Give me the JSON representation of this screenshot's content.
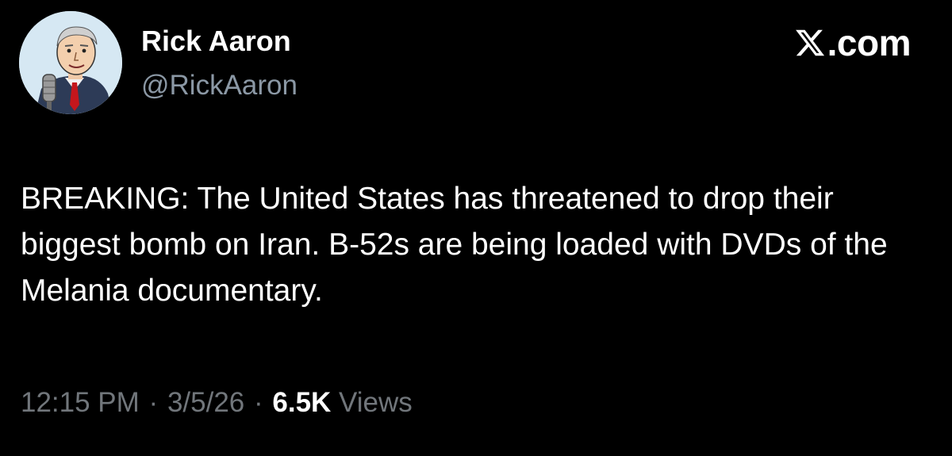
{
  "author": {
    "display_name": "Rick Aaron",
    "handle": "@RickAaron",
    "avatar_icon": "caricature-avatar-icon"
  },
  "source": {
    "logo_icon": "x-logo-icon",
    "label": ".com"
  },
  "tweet": {
    "text": "BREAKING: The United States has threatened to drop their biggest bomb on Iran. B-52s are being loaded with DVDs of the Melania documentary."
  },
  "meta": {
    "time": "12:15 PM",
    "separator": "·",
    "date": "3/5/26",
    "views_count": "6.5K",
    "views_label": "Views"
  },
  "colors": {
    "background": "#000000",
    "primary_text": "#ffffff",
    "secondary_text": "#71767b"
  }
}
